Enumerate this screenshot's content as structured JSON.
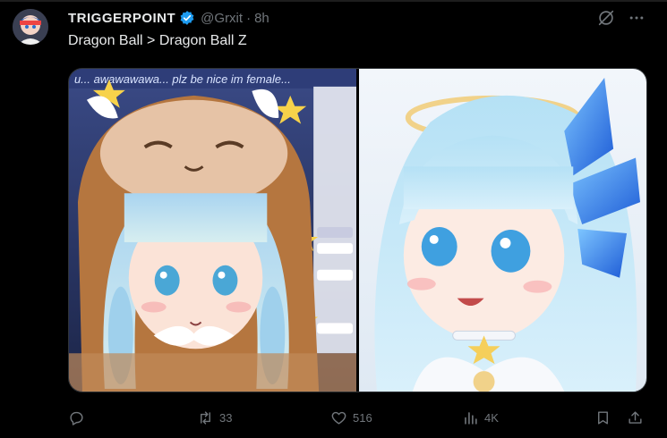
{
  "tweet": {
    "display_name": "TRIGGERPOINT",
    "handle": "@Grxit",
    "separator": "·",
    "time": "8h",
    "text": "Dragon Ball > Dragon Ball Z",
    "media_captions": {
      "left_banner": "u... awawawawa... plz be nice im female..."
    },
    "stats": {
      "replies": "",
      "retweets": "33",
      "likes": "516",
      "views": "4K"
    }
  },
  "icons": {
    "verified": "verified-badge-icon",
    "grok": "grok-icon",
    "more": "more-icon",
    "reply": "reply-icon",
    "retweet": "retweet-icon",
    "like": "heart-icon",
    "views": "views-icon",
    "bookmark": "bookmark-icon",
    "share": "share-icon"
  },
  "colors": {
    "background": "#000000",
    "text": "#e7e9ea",
    "muted": "#71767b",
    "verified": "#1d9bf0"
  }
}
